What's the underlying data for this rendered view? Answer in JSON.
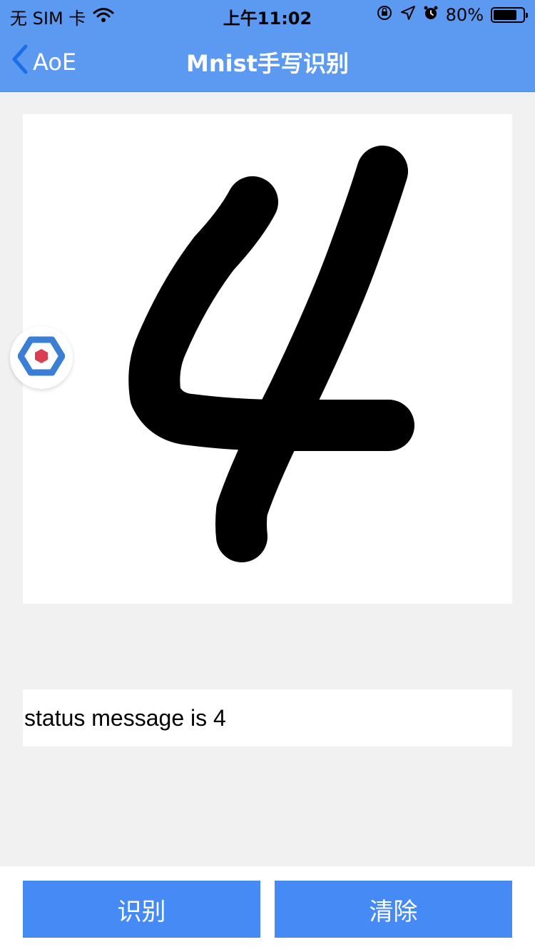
{
  "status_bar": {
    "carrier": "无 SIM 卡",
    "time": "上午11:02",
    "battery_percent": "80%",
    "battery_level": 0.8,
    "icons": [
      "wifi-icon",
      "orientation-lock-icon",
      "location-arrow-icon",
      "alarm-icon",
      "battery-icon"
    ]
  },
  "nav": {
    "back_label": "AoE",
    "title": "Mnist手写识别"
  },
  "canvas": {
    "drawn_digit": "4",
    "stroke_color": "#000000",
    "background": "#ffffff"
  },
  "floating_button": {
    "icon": "aoe-logo-icon"
  },
  "result": {
    "status_message": "status message is 4"
  },
  "actions": {
    "recognize_label": "识别",
    "clear_label": "清除"
  },
  "colors": {
    "header_blue": "#5b9af0",
    "button_blue": "#468af6",
    "page_background": "#f1f1f1"
  }
}
